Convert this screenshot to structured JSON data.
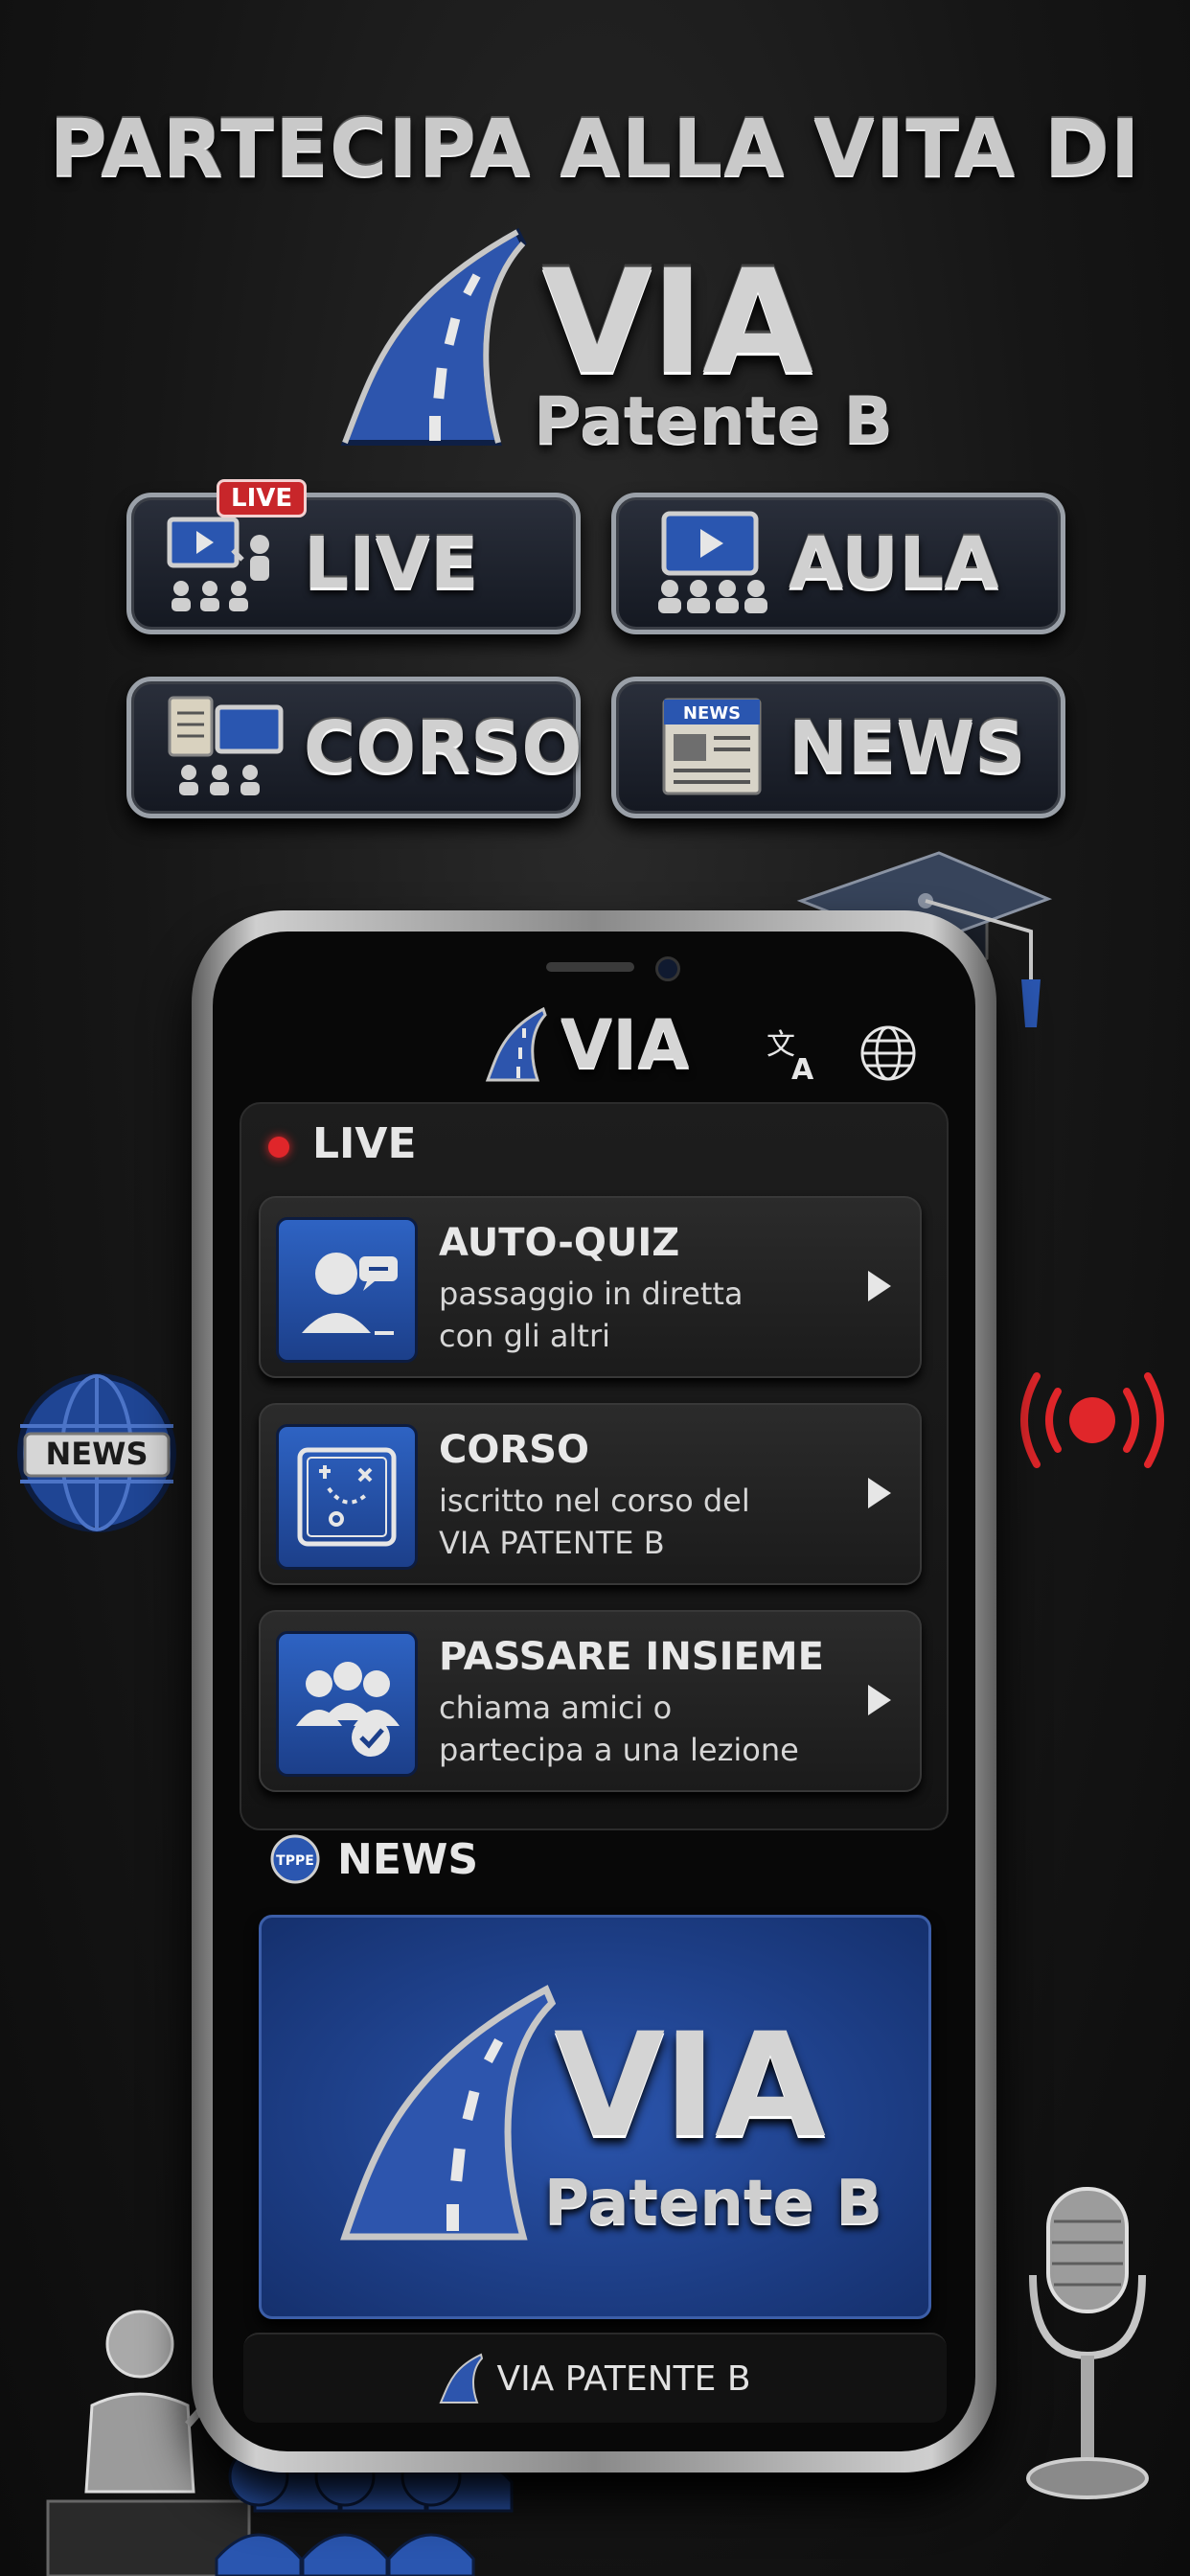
{
  "header": {
    "headline": "PARTECIPA ALLA VITA DI",
    "brand_name": "VIA",
    "brand_sub": "Patente B"
  },
  "badges": [
    {
      "label": "LIVE",
      "tag": "LIVE",
      "icon": "live-teacher-icon"
    },
    {
      "label": "AULA",
      "icon": "classroom-screen-icon"
    },
    {
      "label": "CORSO",
      "icon": "course-board-icon"
    },
    {
      "label": "NEWS",
      "icon": "newspaper-icon",
      "tag": "NEWS"
    }
  ],
  "phone": {
    "app_title": "VIA",
    "translate_icon": "translate-icon",
    "globe_icon": "globe-icon",
    "live_section": {
      "title": "LIVE",
      "items": [
        {
          "title": "AUTO-QUIZ",
          "line1": "passaggio in diretta",
          "line2": "con gli altri",
          "icon": "user-chat-icon"
        },
        {
          "title": "CORSO",
          "line1": "iscritto nel corso del",
          "line2": "VIA PATENTE B",
          "icon": "tactics-board-icon"
        },
        {
          "title": "PASSARE INSIEME",
          "line1": "chiama amici o",
          "line2": "partecipa a una lezione",
          "icon": "group-check-icon"
        }
      ]
    },
    "news_section": {
      "title": "NEWS",
      "badge_text": "TPPE",
      "card_brand": "VIA",
      "card_sub": "Patente B"
    },
    "footer": "VIA PATENTE B"
  },
  "decor": {
    "news_globe_text": "NEWS"
  },
  "colors": {
    "background": "#161616",
    "accent_blue": "#2a56b0",
    "live_red": "#e0262a",
    "metal": "#c9c9c9"
  }
}
